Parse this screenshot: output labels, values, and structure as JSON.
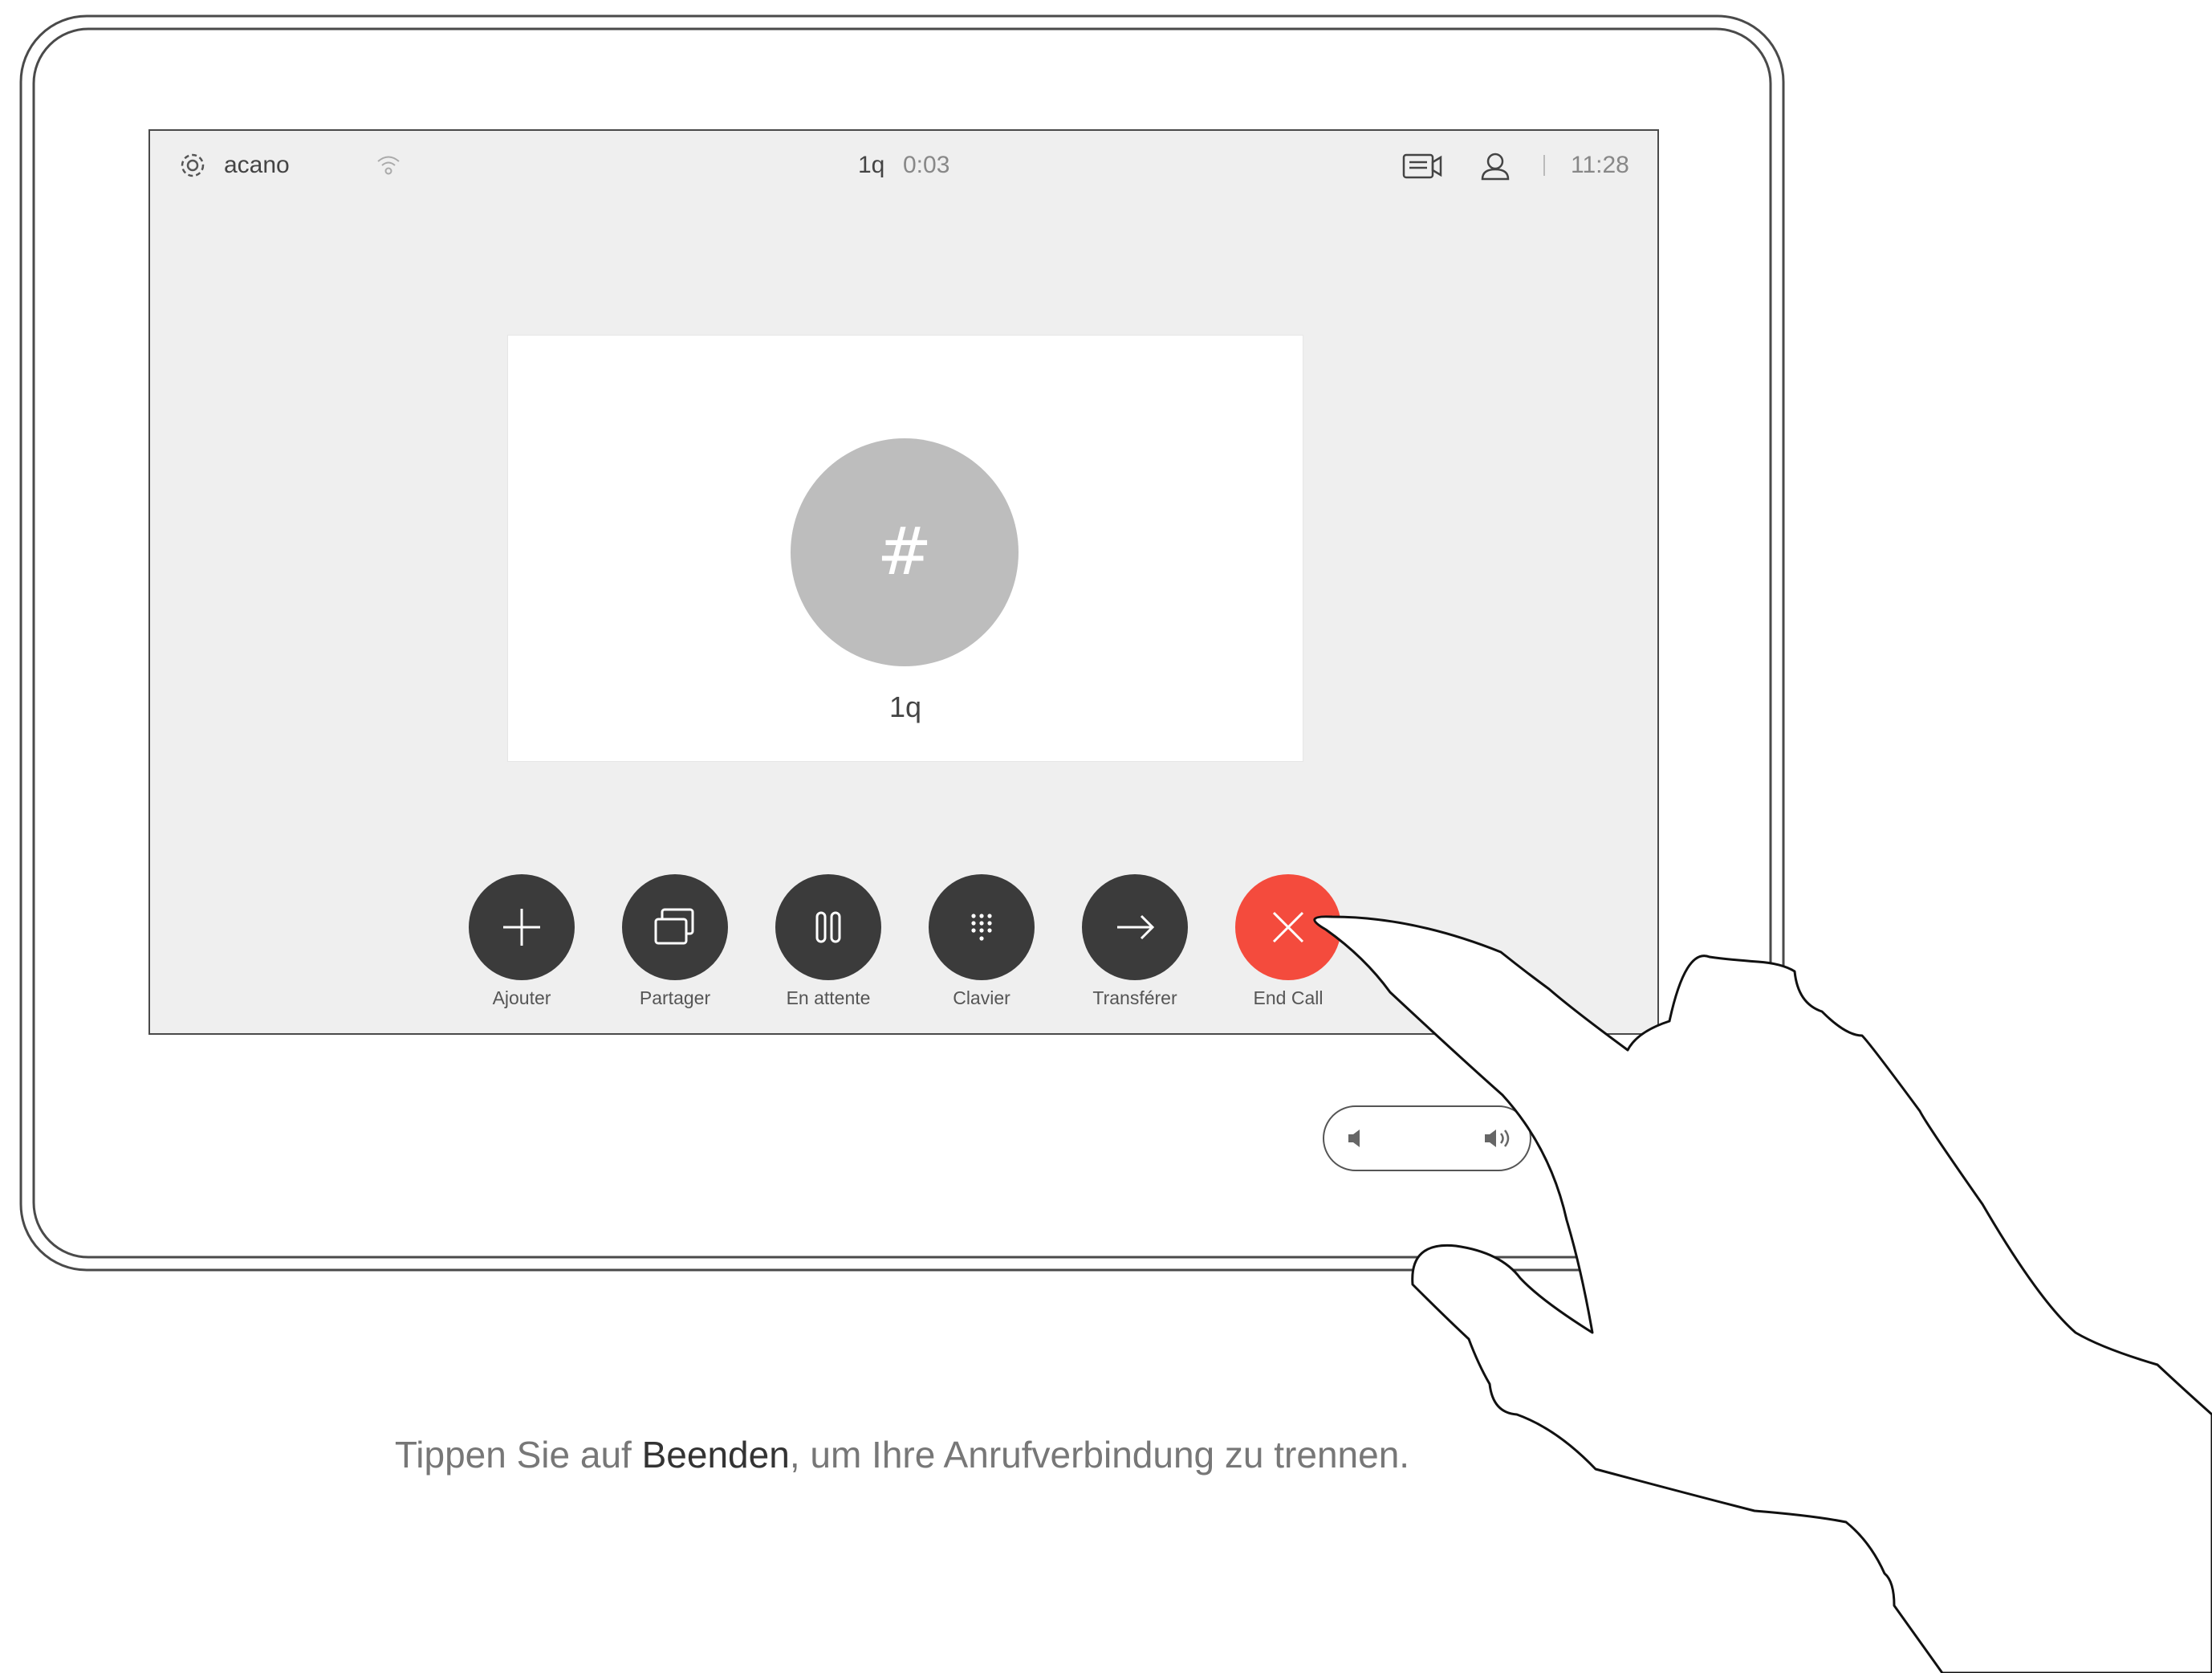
{
  "status_bar": {
    "system_name": "acano",
    "call_name": "1q",
    "call_duration": "0:03",
    "time": "11:28"
  },
  "call": {
    "avatar_symbol": "#",
    "caller_name": "1q"
  },
  "controls": [
    {
      "id": "add",
      "label": "Ajouter",
      "icon": "plus-icon"
    },
    {
      "id": "share",
      "label": "Partager",
      "icon": "share-screens-icon"
    },
    {
      "id": "hold",
      "label": "En attente",
      "icon": "pause-icon"
    },
    {
      "id": "keypad",
      "label": "Clavier",
      "icon": "keypad-icon"
    },
    {
      "id": "transfer",
      "label": "Transférer",
      "icon": "arrow-right-icon"
    },
    {
      "id": "end",
      "label": "End Call",
      "icon": "close-icon"
    }
  ],
  "instruction": {
    "before": "Tippen Sie auf ",
    "emphasis": "Beenden",
    "after": ", um Ihre Anrufverbindung zu trennen."
  },
  "colors": {
    "screen_bg": "#efefef",
    "button_dark": "#3b3b3b",
    "end_call_red": "#f44b3d",
    "avatar_gray": "#bdbdbd"
  }
}
